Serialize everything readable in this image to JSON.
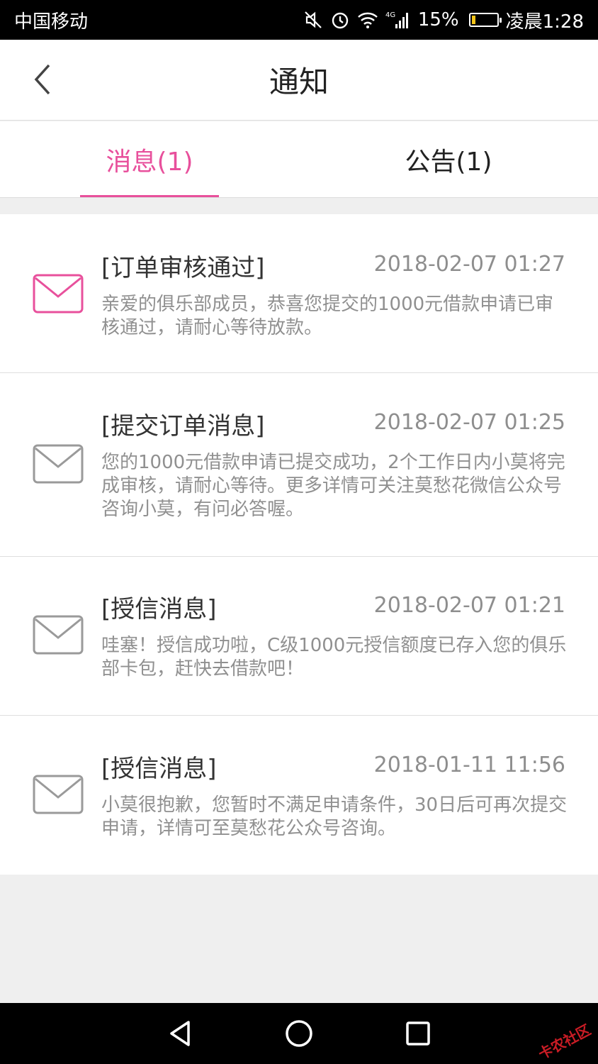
{
  "status_bar": {
    "carrier": "中国移动",
    "network": "4G",
    "battery": "15%",
    "battery_level": 0.15,
    "time": "凌晨1:28",
    "icons": [
      "mute-icon",
      "alarm-icon",
      "wifi-icon",
      "signal-icon",
      "battery-icon"
    ]
  },
  "header": {
    "title": "通知"
  },
  "tabs": [
    {
      "label": "消息(1)",
      "active": true
    },
    {
      "label": "公告(1)",
      "active": false
    }
  ],
  "messages": [
    {
      "title": "[订单审核通过]",
      "time": "2018-02-07 01:27",
      "body": "亲爱的俱乐部成员，恭喜您提交的1000元借款申请已审核通过，请耐心等待放款。",
      "unread": true
    },
    {
      "title": "[提交订单消息]",
      "time": "2018-02-07 01:25",
      "body": "您的1000元借款申请已提交成功，2个工作日内小莫将完成审核，请耐心等待。更多详情可关注莫愁花微信公众号咨询小莫，有问必答喔。",
      "unread": false
    },
    {
      "title": "[授信消息]",
      "time": "2018-02-07 01:21",
      "body": "哇塞！授信成功啦，C级1000元授信额度已存入您的俱乐部卡包，赶快去借款吧！",
      "unread": false
    },
    {
      "title": "[授信消息]",
      "time": "2018-01-11 11:56",
      "body": "小莫很抱歉，您暂时不满足申请条件，30日后可再次提交申请，详情可至莫愁花公众号咨询。",
      "unread": false
    }
  ],
  "colors": {
    "accent": "#e8509c",
    "read_icon": "#9a9a9a"
  },
  "watermark": "卡农社区"
}
